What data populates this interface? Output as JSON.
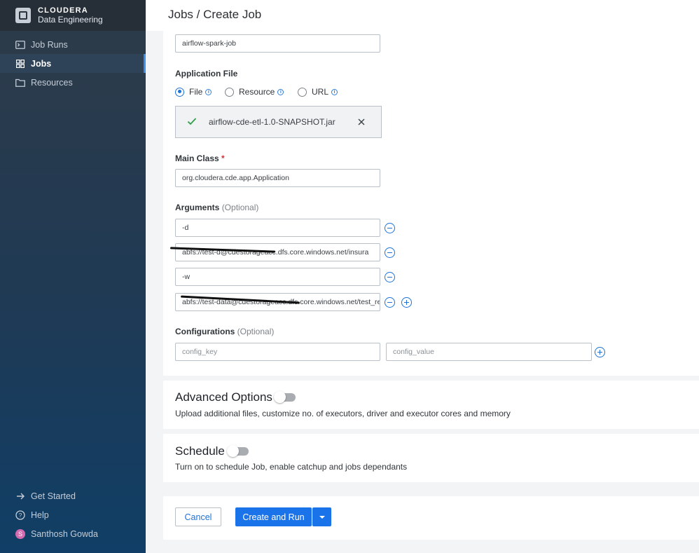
{
  "brand": {
    "name": "CLOUDERA",
    "subtitle": "Data Engineering"
  },
  "sidebar": {
    "items": [
      {
        "label": "Job Runs",
        "icon": "terminal-icon",
        "active": false
      },
      {
        "label": "Jobs",
        "icon": "grid-icon",
        "active": true
      },
      {
        "label": "Resources",
        "icon": "folder-icon",
        "active": false
      }
    ],
    "bottom": [
      {
        "label": "Get Started",
        "icon": "arrow-right-icon"
      },
      {
        "label": "Help",
        "icon": "help-icon"
      },
      {
        "label": "Santhosh Gowda",
        "icon": "avatar",
        "avatar_letter": "S"
      }
    ]
  },
  "header": {
    "title": "Jobs / Create Job"
  },
  "form": {
    "job_name": "airflow-spark-job",
    "application_file": {
      "label": "Application File",
      "options": [
        "File",
        "Resource",
        "URL"
      ],
      "selected": "File",
      "uploaded_file": "airflow-cde-etl-1.0-SNAPSHOT.jar"
    },
    "main_class": {
      "label": "Main Class",
      "required_mark": "*",
      "value": "org.cloudera.cde.app.Application"
    },
    "arguments": {
      "label": "Arguments",
      "optional": "(Optional)",
      "values": [
        "-d",
        "abfs://test-d@cdestorageacc.dfs.core.windows.net/insura",
        "-w",
        "abfs://test-data@cdestorageacc.dfs.core.windows.net/test_re"
      ]
    },
    "configurations": {
      "label": "Configurations",
      "optional": "(Optional)",
      "key_placeholder": "config_key",
      "value_placeholder": "config_value"
    }
  },
  "advanced": {
    "title": "Advanced Options",
    "description": "Upload additional files, customize no. of executors, driver and executor cores and memory",
    "enabled": false
  },
  "schedule": {
    "title": "Schedule",
    "description": "Turn on to schedule Job, enable catchup and jobs dependants",
    "enabled": false
  },
  "actions": {
    "cancel": "Cancel",
    "primary": "Create and Run"
  },
  "colors": {
    "accent": "#1a73e8",
    "sidebar": "#1f3a55",
    "required": "#d3323c"
  }
}
